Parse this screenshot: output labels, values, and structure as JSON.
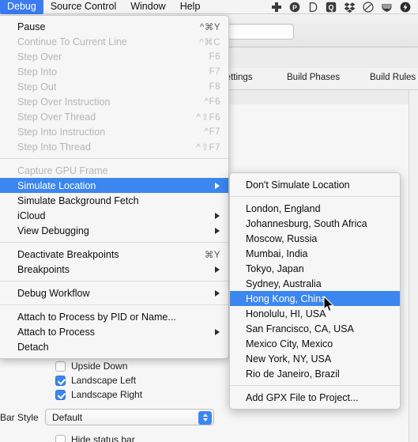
{
  "menubar": {
    "items": [
      {
        "label": "Debug",
        "active": true
      },
      {
        "label": "Source Control",
        "active": false
      },
      {
        "label": "Window",
        "active": false
      },
      {
        "label": "Help",
        "active": false
      }
    ],
    "status_icons": [
      "plus-cross-icon",
      "p-circle-icon",
      "d-outline-icon",
      "q-square-icon",
      "dropbox-icon",
      "circle-slash-icon",
      "shield-stripes-icon",
      "lightning-bolt-icon"
    ]
  },
  "background": {
    "search_placeholder": "",
    "search_value": "",
    "tabs": [
      {
        "label": "Settings"
      },
      {
        "label": "Build Phases"
      },
      {
        "label": "Build Rules"
      }
    ]
  },
  "debug_menu": {
    "groups": [
      {
        "items": [
          {
            "label": "Pause",
            "shortcut": "^⌘Y",
            "disabled": false,
            "submenu": false,
            "selected": false
          },
          {
            "label": "Continue To Current Line",
            "shortcut": "^⌘C",
            "disabled": true,
            "submenu": false,
            "selected": false
          },
          {
            "label": "Step Over",
            "shortcut": "F6",
            "disabled": true,
            "submenu": false,
            "selected": false
          },
          {
            "label": "Step Into",
            "shortcut": "F7",
            "disabled": true,
            "submenu": false,
            "selected": false
          },
          {
            "label": "Step Out",
            "shortcut": "F8",
            "disabled": true,
            "submenu": false,
            "selected": false
          },
          {
            "label": "Step Over Instruction",
            "shortcut": "^F6",
            "disabled": true,
            "submenu": false,
            "selected": false
          },
          {
            "label": "Step Over Thread",
            "shortcut": "^⇧F6",
            "disabled": true,
            "submenu": false,
            "selected": false
          },
          {
            "label": "Step Into Instruction",
            "shortcut": "^F7",
            "disabled": true,
            "submenu": false,
            "selected": false
          },
          {
            "label": "Step Into Thread",
            "shortcut": "^⇧F7",
            "disabled": true,
            "submenu": false,
            "selected": false
          }
        ]
      },
      {
        "items": [
          {
            "label": "Capture GPU Frame",
            "shortcut": "",
            "disabled": true,
            "submenu": false,
            "selected": false
          },
          {
            "label": "Simulate Location",
            "shortcut": "",
            "disabled": false,
            "submenu": true,
            "selected": true
          },
          {
            "label": "Simulate Background Fetch",
            "shortcut": "",
            "disabled": false,
            "submenu": false,
            "selected": false
          },
          {
            "label": "iCloud",
            "shortcut": "",
            "disabled": false,
            "submenu": true,
            "selected": false
          },
          {
            "label": "View Debugging",
            "shortcut": "",
            "disabled": false,
            "submenu": true,
            "selected": false
          }
        ]
      },
      {
        "items": [
          {
            "label": "Deactivate Breakpoints",
            "shortcut": "⌘Y",
            "disabled": false,
            "submenu": false,
            "selected": false
          },
          {
            "label": "Breakpoints",
            "shortcut": "",
            "disabled": false,
            "submenu": true,
            "selected": false
          }
        ]
      },
      {
        "items": [
          {
            "label": "Debug Workflow",
            "shortcut": "",
            "disabled": false,
            "submenu": true,
            "selected": false
          }
        ]
      },
      {
        "items": [
          {
            "label": "Attach to Process by PID or Name...",
            "shortcut": "",
            "disabled": false,
            "submenu": false,
            "selected": false
          },
          {
            "label": "Attach to Process",
            "shortcut": "",
            "disabled": false,
            "submenu": true,
            "selected": false
          },
          {
            "label": "Detach",
            "shortcut": "",
            "disabled": false,
            "submenu": false,
            "selected": false
          }
        ]
      }
    ]
  },
  "location_submenu": {
    "groups": [
      {
        "items": [
          {
            "label": "Don't Simulate Location",
            "selected": false
          }
        ]
      },
      {
        "items": [
          {
            "label": "London, England",
            "selected": false
          },
          {
            "label": "Johannesburg, South Africa",
            "selected": false
          },
          {
            "label": "Moscow, Russia",
            "selected": false
          },
          {
            "label": "Mumbai, India",
            "selected": false
          },
          {
            "label": "Tokyo, Japan",
            "selected": false
          },
          {
            "label": "Sydney, Australia",
            "selected": false
          },
          {
            "label": "Hong Kong, China",
            "selected": true
          },
          {
            "label": "Honolulu, HI, USA",
            "selected": false
          },
          {
            "label": "San Francisco, CA, USA",
            "selected": false
          },
          {
            "label": "Mexico City, Mexico",
            "selected": false
          },
          {
            "label": "New York, NY, USA",
            "selected": false
          },
          {
            "label": "Rio de Janeiro, Brazil",
            "selected": false
          }
        ]
      },
      {
        "items": [
          {
            "label": "Add GPX File to Project...",
            "selected": false
          }
        ]
      }
    ]
  },
  "inspector": {
    "orientation": [
      {
        "label": "Upside Down",
        "checked": false
      },
      {
        "label": "Landscape Left",
        "checked": true
      },
      {
        "label": "Landscape Right",
        "checked": true
      }
    ],
    "bar_style_label": "Bar Style",
    "bar_style_value": "Default",
    "hide_status_bar": {
      "label": "Hide status bar",
      "checked": false
    }
  },
  "colors": {
    "accent_blue": "#3c86f0",
    "menubar_highlight": "#3c7cf0",
    "menu_background": "#f6f6f6",
    "disabled_text": "#b6b6b6"
  }
}
